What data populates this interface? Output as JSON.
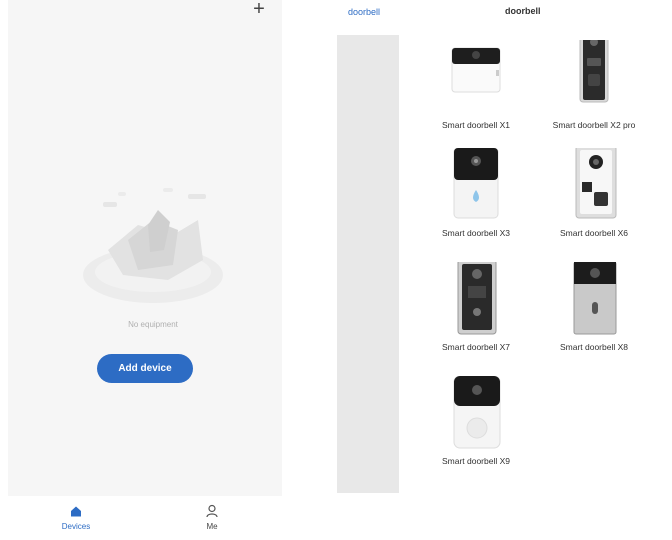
{
  "left": {
    "add_icon": "plus-icon",
    "empty_text": "No equipment",
    "add_device_label": "Add device",
    "nav": [
      {
        "label": "Devices",
        "icon": "home-icon",
        "active": true
      },
      {
        "label": "Me",
        "icon": "person-icon",
        "active": false
      }
    ]
  },
  "right": {
    "category_label": "doorbell",
    "section_title": "doorbell",
    "products": [
      {
        "name": "Smart doorbell X1"
      },
      {
        "name": "Smart doorbell X2 pro"
      },
      {
        "name": "Smart doorbell X3"
      },
      {
        "name": "Smart doorbell X6"
      },
      {
        "name": "Smart doorbell X7"
      },
      {
        "name": "Smart doorbell X8"
      },
      {
        "name": "Smart doorbell X9"
      }
    ]
  },
  "colors": {
    "accent": "#2d6cc4",
    "sidebar": "#e8e8e8",
    "screen_bg": "#f6f6f6"
  }
}
